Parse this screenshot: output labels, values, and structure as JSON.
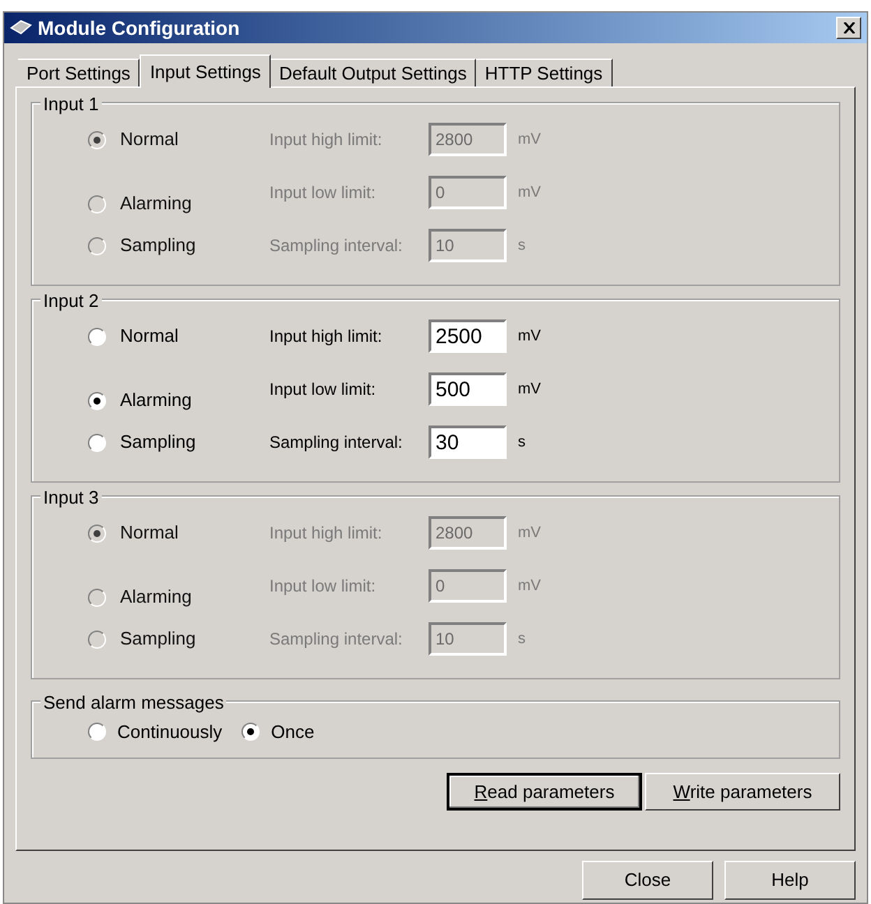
{
  "window": {
    "title": "Module Configuration"
  },
  "tabs": [
    {
      "label": "Port Settings",
      "selected": false
    },
    {
      "label": "Input Settings",
      "selected": true
    },
    {
      "label": "Default Output Settings",
      "selected": false
    },
    {
      "label": "HTTP Settings",
      "selected": false
    }
  ],
  "inputs": [
    {
      "title": "Input 1",
      "disabled": true,
      "modes": [
        {
          "label": "Normal",
          "selected": true
        },
        {
          "label": "Alarming",
          "selected": false
        },
        {
          "label": "Sampling",
          "selected": false
        }
      ],
      "fields": [
        {
          "label": "Input high limit:",
          "value": "2800",
          "unit": "mV"
        },
        {
          "label": "Input low limit:",
          "value": "0",
          "unit": "mV"
        },
        {
          "label": "Sampling interval:",
          "value": "10",
          "unit": "s"
        }
      ]
    },
    {
      "title": "Input 2",
      "disabled": false,
      "modes": [
        {
          "label": "Normal",
          "selected": false
        },
        {
          "label": "Alarming",
          "selected": true
        },
        {
          "label": "Sampling",
          "selected": false
        }
      ],
      "fields": [
        {
          "label": "Input high limit:",
          "value": "2500",
          "unit": "mV"
        },
        {
          "label": "Input low limit:",
          "value": "500",
          "unit": "mV"
        },
        {
          "label": "Sampling interval:",
          "value": "30",
          "unit": "s"
        }
      ]
    },
    {
      "title": "Input 3",
      "disabled": true,
      "modes": [
        {
          "label": "Normal",
          "selected": true
        },
        {
          "label": "Alarming",
          "selected": false
        },
        {
          "label": "Sampling",
          "selected": false
        }
      ],
      "fields": [
        {
          "label": "Input high limit:",
          "value": "2800",
          "unit": "mV"
        },
        {
          "label": "Input low limit:",
          "value": "0",
          "unit": "mV"
        },
        {
          "label": "Sampling interval:",
          "value": "10",
          "unit": "s"
        }
      ]
    }
  ],
  "alarm_messages": {
    "title": "Send alarm messages",
    "options": [
      {
        "label": "Continuously",
        "selected": false
      },
      {
        "label": "Once",
        "selected": true
      }
    ]
  },
  "panel_buttons": [
    {
      "label": "Read parameters",
      "default": true,
      "underline_first": true
    },
    {
      "label": "Write parameters",
      "default": false,
      "underline_first": true
    }
  ],
  "dialog_buttons": [
    {
      "label": "Close"
    },
    {
      "label": "Help"
    }
  ]
}
